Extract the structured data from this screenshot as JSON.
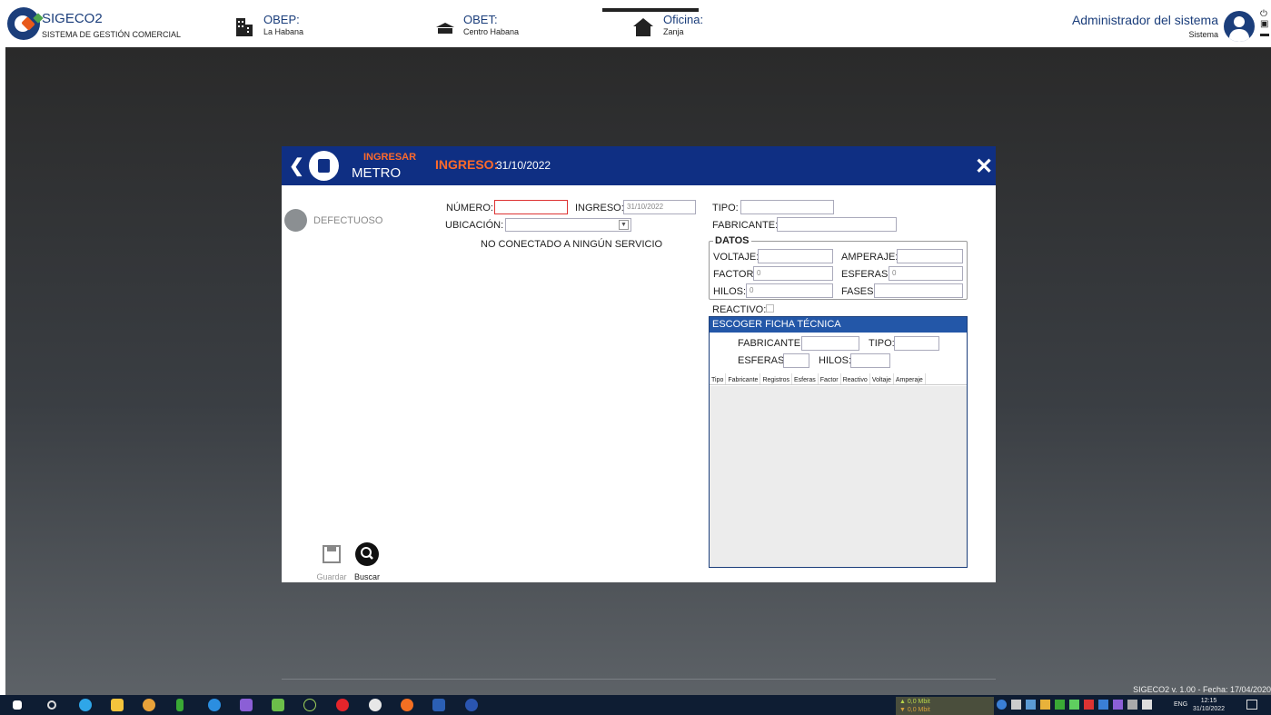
{
  "app": {
    "name": "SIGECO2",
    "subtitle": "SISTEMA DE GESTIÓN COMERCIAL"
  },
  "locations": [
    {
      "label": "OBEP:",
      "value": "La Habana"
    },
    {
      "label": "OBET:",
      "value": "Centro Habana"
    },
    {
      "label": "Oficina:",
      "value": "Zanja"
    }
  ],
  "user": {
    "name": "Administrador del sistema",
    "role": "Sistema"
  },
  "modal": {
    "operation": "INGRESAR",
    "entity": "METRO",
    "ingreso_label": "INGRESO:",
    "ingreso_date": "31/10/2022",
    "side_option": "DEFECTUOSO",
    "form": {
      "numero_label": "NÚMERO:",
      "numero_value": "",
      "ingreso_label": "INGRESO:",
      "ingreso_value": "31/10/2022",
      "ubicacion_label": "UBICACIÓN:",
      "ubicacion_value": "",
      "status": "NO CONECTADO A NINGÚN SERVICIO",
      "tipo_label": "TIPO:",
      "tipo_value": "",
      "fabricante_label": "FABRICANTE:",
      "fabricante_value": ""
    },
    "datos": {
      "legend": "DATOS",
      "voltaje_label": "VOLTAJE:",
      "voltaje_value": "",
      "amperaje_label": "AMPERAJE:",
      "amperaje_value": "",
      "factor_label": "FACTOR:",
      "factor_value": "0",
      "esferas_label": "ESFERAS:",
      "esferas_value": "0",
      "hilos_label": "HILOS:",
      "hilos_value": "0",
      "fases_label": "FASES:",
      "fases_value": ""
    },
    "reactivo_label": "REACTIVO:",
    "ficha": {
      "title": "ESCOGER FICHA TÉCNICA",
      "fabricante_label": "FABRICANTE:",
      "tipo_label": "TIPO:",
      "esferas_label": "ESFERAS:",
      "hilos_label": "HILOS:",
      "columns": [
        "Tipo",
        "Fabricante",
        "Registros",
        "Esferas",
        "Factor",
        "Reactivo",
        "Voltaje",
        "Amperaje"
      ]
    },
    "actions": {
      "save": "Guardar",
      "search": "Buscar"
    }
  },
  "footer": {
    "version": "SIGECO2 v. 1.00 - Fecha: 17/04/2020"
  },
  "taskbar": {
    "net_up": "▲ 0,0 Mbit",
    "net_down": "▼ 0,0 Mbit",
    "lang": "ENG",
    "time": "12:15",
    "date": "31/10/2022"
  }
}
